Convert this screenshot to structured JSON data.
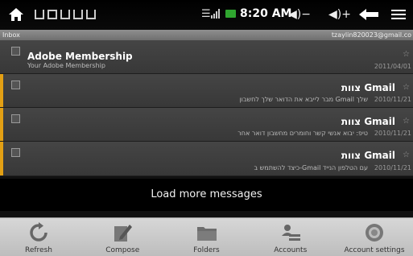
{
  "status_bar": {
    "time": "8:20 AM",
    "icons": [
      "home-icon",
      "usb-icon",
      "gmail-notification-icon",
      "sd-card-icon",
      "download-icon",
      "wifi-icon",
      "signal-icon",
      "battery-icon",
      "volume-down-icon",
      "volume-up-icon",
      "back-icon",
      "menu-icon"
    ]
  },
  "title_bar": {
    "label": "Inbox",
    "account": "tzaylin820023@gmail.co"
  },
  "messages": [
    {
      "from": "Adobe Membership",
      "subject": "Your Adobe Membership",
      "date": "2011/04/01",
      "starred": true
    },
    {
      "from": "צוות Gmail",
      "subject": "מבר לייבא את הדואר שלך לחשבון Gmail שלך",
      "date": "2010/11/21"
    },
    {
      "from": "צוות Gmail",
      "subject": "טיפ: יבוא אנשי קשר וחומרים מחשבון דואר אחר",
      "date": "2010/11/21"
    },
    {
      "from": "צוות Gmail",
      "subject": "כיצד להשתמש ב-Gmail עם הטלפון הנייד",
      "date": "2010/11/21"
    }
  ],
  "load_more_label": "Load more messages",
  "toolbar": {
    "refresh": "Refresh",
    "compose": "Compose",
    "folders": "Folders",
    "accounts": "Accounts",
    "account_settings": "Account settings"
  },
  "colors": {
    "unread_bar": "#e3a014",
    "battery": "#2fa52f"
  }
}
